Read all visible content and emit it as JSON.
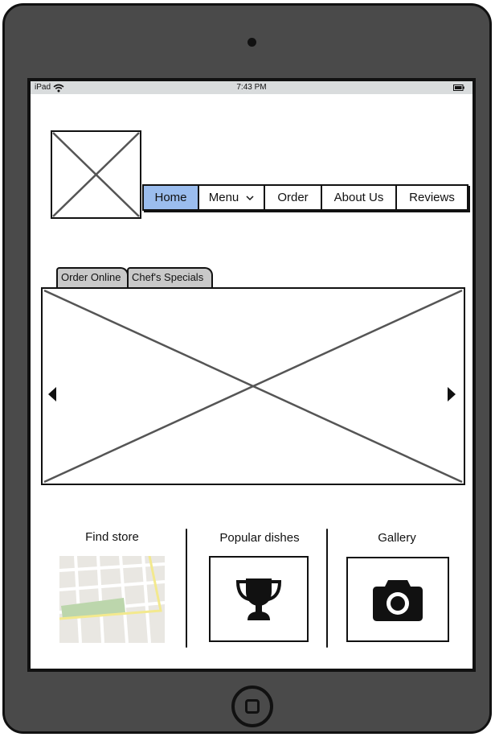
{
  "status_bar": {
    "device": "iPad",
    "time": "7:43 PM"
  },
  "nav": {
    "items": [
      {
        "label": "Home",
        "active": true
      },
      {
        "label": "Menu",
        "has_dropdown": true
      },
      {
        "label": "Order"
      },
      {
        "label": "About Us"
      },
      {
        "label": "Reviews"
      }
    ]
  },
  "tabs": [
    {
      "label": "Order Online"
    },
    {
      "label": "Chef's Specials"
    }
  ],
  "features": {
    "find_store": {
      "title": "Find store",
      "icon": "map-icon"
    },
    "popular_dishes": {
      "title": "Popular dishes",
      "icon": "trophy-icon"
    },
    "gallery": {
      "title": "Gallery",
      "icon": "camera-icon"
    }
  },
  "colors": {
    "device_body": "#4a4a4a",
    "nav_active": "#9bbdee",
    "tab_bg": "#c9c9c9",
    "status_bar": "#d9dcdd"
  }
}
